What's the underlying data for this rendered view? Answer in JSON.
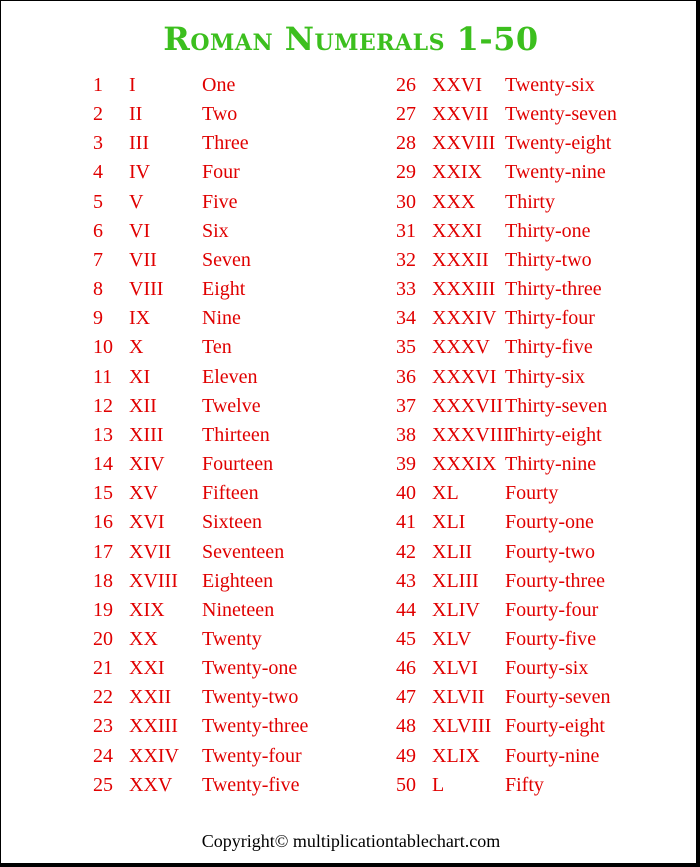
{
  "title": "Roman Numerals 1-50",
  "accent_colors": {
    "title": "#3cbf1e",
    "text": "#e00000"
  },
  "left_column": [
    {
      "n": "1",
      "roman": "I",
      "word": "One"
    },
    {
      "n": "2",
      "roman": "II",
      "word": "Two"
    },
    {
      "n": "3",
      "roman": "III",
      "word": "Three"
    },
    {
      "n": "4",
      "roman": "IV",
      "word": "Four"
    },
    {
      "n": "5",
      "roman": "V",
      "word": "Five"
    },
    {
      "n": "6",
      "roman": "VI",
      "word": "Six"
    },
    {
      "n": "7",
      "roman": "VII",
      "word": "Seven"
    },
    {
      "n": "8",
      "roman": "VIII",
      "word": "Eight"
    },
    {
      "n": "9",
      "roman": "IX",
      "word": "Nine"
    },
    {
      "n": "10",
      "roman": "X",
      "word": "Ten"
    },
    {
      "n": "11",
      "roman": "XI",
      "word": "Eleven"
    },
    {
      "n": "12",
      "roman": "XII",
      "word": "Twelve"
    },
    {
      "n": "13",
      "roman": "XIII",
      "word": "Thirteen"
    },
    {
      "n": "14",
      "roman": "XIV",
      "word": "Fourteen"
    },
    {
      "n": "15",
      "roman": "XV",
      "word": "Fifteen"
    },
    {
      "n": "16",
      "roman": "XVI",
      "word": "Sixteen"
    },
    {
      "n": "17",
      "roman": "XVII",
      "word": "Seventeen"
    },
    {
      "n": "18",
      "roman": "XVIII",
      "word": "Eighteen"
    },
    {
      "n": "19",
      "roman": "XIX",
      "word": "Nineteen"
    },
    {
      "n": "20",
      "roman": "XX",
      "word": "Twenty"
    },
    {
      "n": "21",
      "roman": "XXI",
      "word": "Twenty-one"
    },
    {
      "n": "22",
      "roman": "XXII",
      "word": "Twenty-two"
    },
    {
      "n": "23",
      "roman": "XXIII",
      "word": "Twenty-three"
    },
    {
      "n": "24",
      "roman": "XXIV",
      "word": "Twenty-four"
    },
    {
      "n": "25",
      "roman": "XXV",
      "word": "Twenty-five"
    }
  ],
  "right_column": [
    {
      "n": "26",
      "roman": "XXVI",
      "word": "Twenty-six"
    },
    {
      "n": "27",
      "roman": "XXVII",
      "word": "Twenty-seven"
    },
    {
      "n": "28",
      "roman": "XXVIII",
      "word": "Twenty-eight"
    },
    {
      "n": "29",
      "roman": "XXIX",
      "word": "Twenty-nine"
    },
    {
      "n": "30",
      "roman": "XXX",
      "word": "Thirty"
    },
    {
      "n": "31",
      "roman": "XXXI",
      "word": "Thirty-one"
    },
    {
      "n": "32",
      "roman": "XXXII",
      "word": "Thirty-two"
    },
    {
      "n": "33",
      "roman": "XXXIII",
      "word": "Thirty-three"
    },
    {
      "n": "34",
      "roman": "XXXIV",
      "word": "Thirty-four"
    },
    {
      "n": "35",
      "roman": "XXXV",
      "word": "Thirty-five"
    },
    {
      "n": "36",
      "roman": "XXXVI",
      "word": "Thirty-six"
    },
    {
      "n": "37",
      "roman": "XXXVII",
      "word": "Thirty-seven"
    },
    {
      "n": "38",
      "roman": "XXXVIII",
      "word": "Thirty-eight"
    },
    {
      "n": "39",
      "roman": "XXXIX",
      "word": "Thirty-nine"
    },
    {
      "n": "40",
      "roman": "XL",
      "word": "Fourty"
    },
    {
      "n": "41",
      "roman": "XLI",
      "word": "Fourty-one"
    },
    {
      "n": "42",
      "roman": "XLII",
      "word": "Fourty-two"
    },
    {
      "n": "43",
      "roman": "XLIII",
      "word": "Fourty-three"
    },
    {
      "n": "44",
      "roman": "XLIV",
      "word": "Fourty-four"
    },
    {
      "n": "45",
      "roman": "XLV",
      "word": "Fourty-five"
    },
    {
      "n": "46",
      "roman": "XLVI",
      "word": "Fourty-six"
    },
    {
      "n": "47",
      "roman": "XLVII",
      "word": "Fourty-seven"
    },
    {
      "n": "48",
      "roman": "XLVIII",
      "word": "Fourty-eight"
    },
    {
      "n": "49",
      "roman": "XLIX",
      "word": "Fourty-nine"
    },
    {
      "n": "50",
      "roman": "L",
      "word": "Fifty"
    }
  ],
  "footer": "Copyright© multiplicationtablechart.com"
}
